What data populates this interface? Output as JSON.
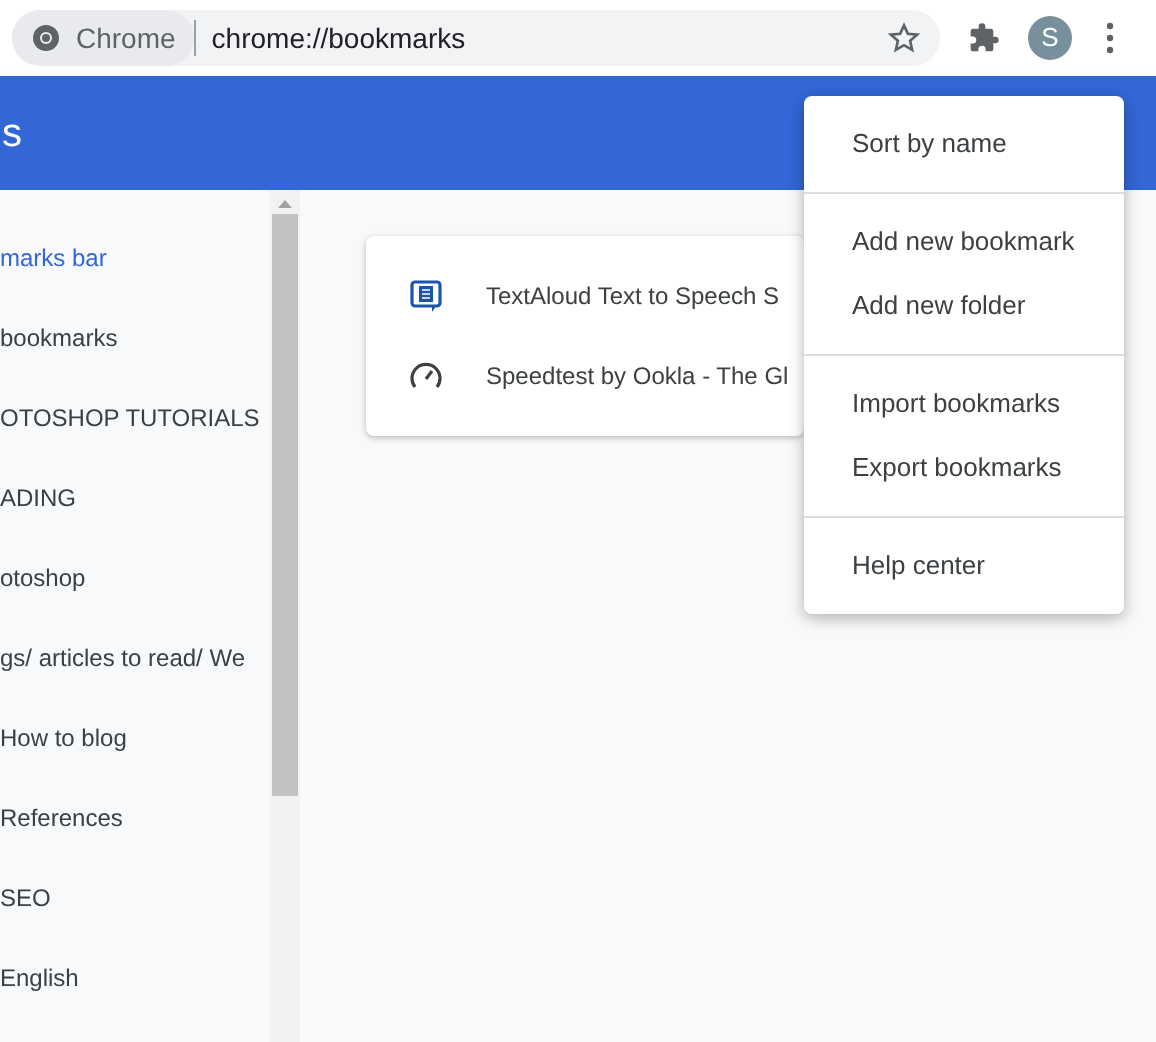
{
  "toolbar": {
    "site_label": "Chrome",
    "address": "chrome://bookmarks",
    "avatar_letter": "S"
  },
  "header": {
    "title": "s"
  },
  "sidebar": {
    "items": [
      {
        "label": "marks bar",
        "selected": true
      },
      {
        "label": "bookmarks",
        "selected": false
      },
      {
        "label": "OTOSHOP TUTORIALS",
        "selected": false
      },
      {
        "label": "ADING",
        "selected": false
      },
      {
        "label": "otoshop",
        "selected": false
      },
      {
        "label": "gs/ articles to read/ We",
        "selected": false
      },
      {
        "label": "How to blog",
        "selected": false
      },
      {
        "label": "References",
        "selected": false
      },
      {
        "label": "SEO",
        "selected": false
      },
      {
        "label": "English",
        "selected": false
      }
    ]
  },
  "bookmarks": [
    {
      "kind": "document",
      "title": "TextAloud Text to Speech S"
    },
    {
      "kind": "gauge",
      "title": "Speedtest by Ookla - The Gl"
    }
  ],
  "menu": {
    "groups": [
      [
        "Sort by name"
      ],
      [
        "Add new bookmark",
        "Add new folder"
      ],
      [
        "Import bookmarks",
        "Export bookmarks"
      ],
      [
        "Help center"
      ]
    ]
  }
}
